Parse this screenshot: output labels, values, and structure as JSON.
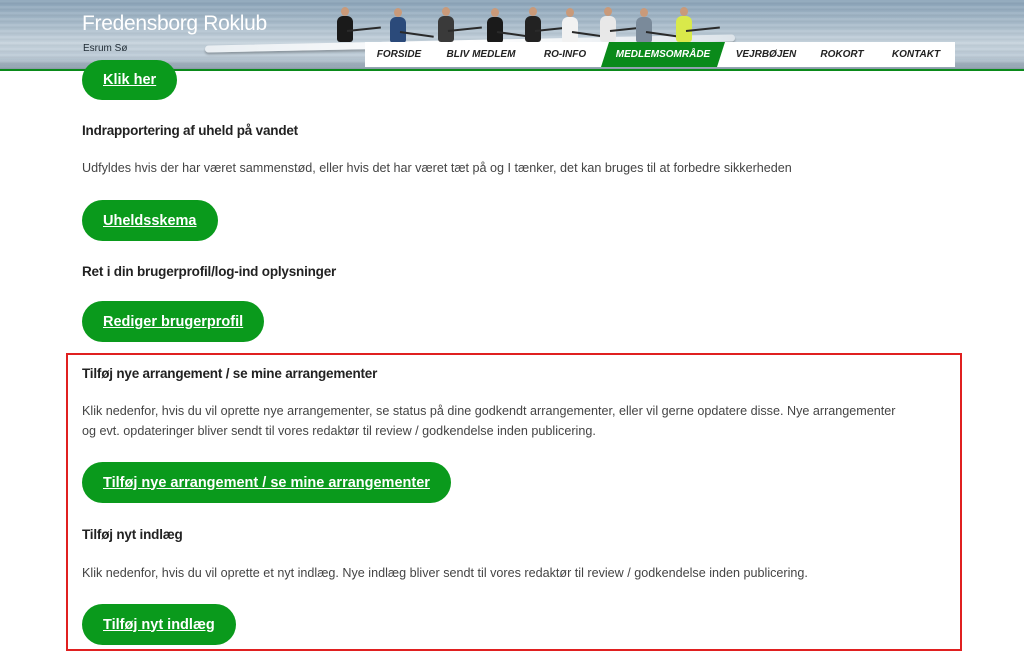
{
  "header": {
    "site_title": "Fredensborg Roklub",
    "site_tagline": "Esrum Sø"
  },
  "nav": {
    "items": [
      {
        "label": "FORSIDE",
        "active": false
      },
      {
        "label": "BLIV MEDLEM",
        "active": false
      },
      {
        "label": "RO-INFO",
        "active": false
      },
      {
        "label": "MEDLEMSOMRÅDE",
        "active": true
      },
      {
        "label": "VEJRBØJEN",
        "active": false
      },
      {
        "label": "ROKORT",
        "active": false
      },
      {
        "label": "KONTAKT",
        "active": false
      }
    ]
  },
  "sections": {
    "top_button": "Klik her",
    "accident": {
      "heading": "Indrapportering af uheld på vandet",
      "text": "Udfyldes hvis der har været sammenstød, eller hvis det har været tæt på og I tænker, det kan bruges til at forbedre sikkerheden",
      "button": "Uheldsskema"
    },
    "profile": {
      "heading": "Ret i din brugerprofil/log-ind oplysninger",
      "button": "Rediger brugerprofil"
    },
    "events": {
      "heading": "Tilføj nye arrangement / se mine arrangementer",
      "text_line1": "Klik nedenfor, hvis du vil oprette nye arrangementer, se status på dine godkendt arrangementer, eller vil gerne opdatere disse. Nye arrangementer",
      "text_line2": "og evt. opdateringer bliver sendt til vores redaktør til review / godkendelse inden publicering.",
      "button": "Tilføj nye arrangement / se mine arrangementer"
    },
    "post": {
      "heading": "Tilføj nyt indlæg",
      "text": "Klik nedenfor, hvis du vil oprette et nyt indlæg. Nye indlæg bliver sendt til vores redaktør til review / godkendelse inden publicering.",
      "button": "Tilføj nyt indlæg"
    }
  },
  "colors": {
    "brand_green": "#0a9a1c",
    "highlight_red": "#e02020"
  }
}
